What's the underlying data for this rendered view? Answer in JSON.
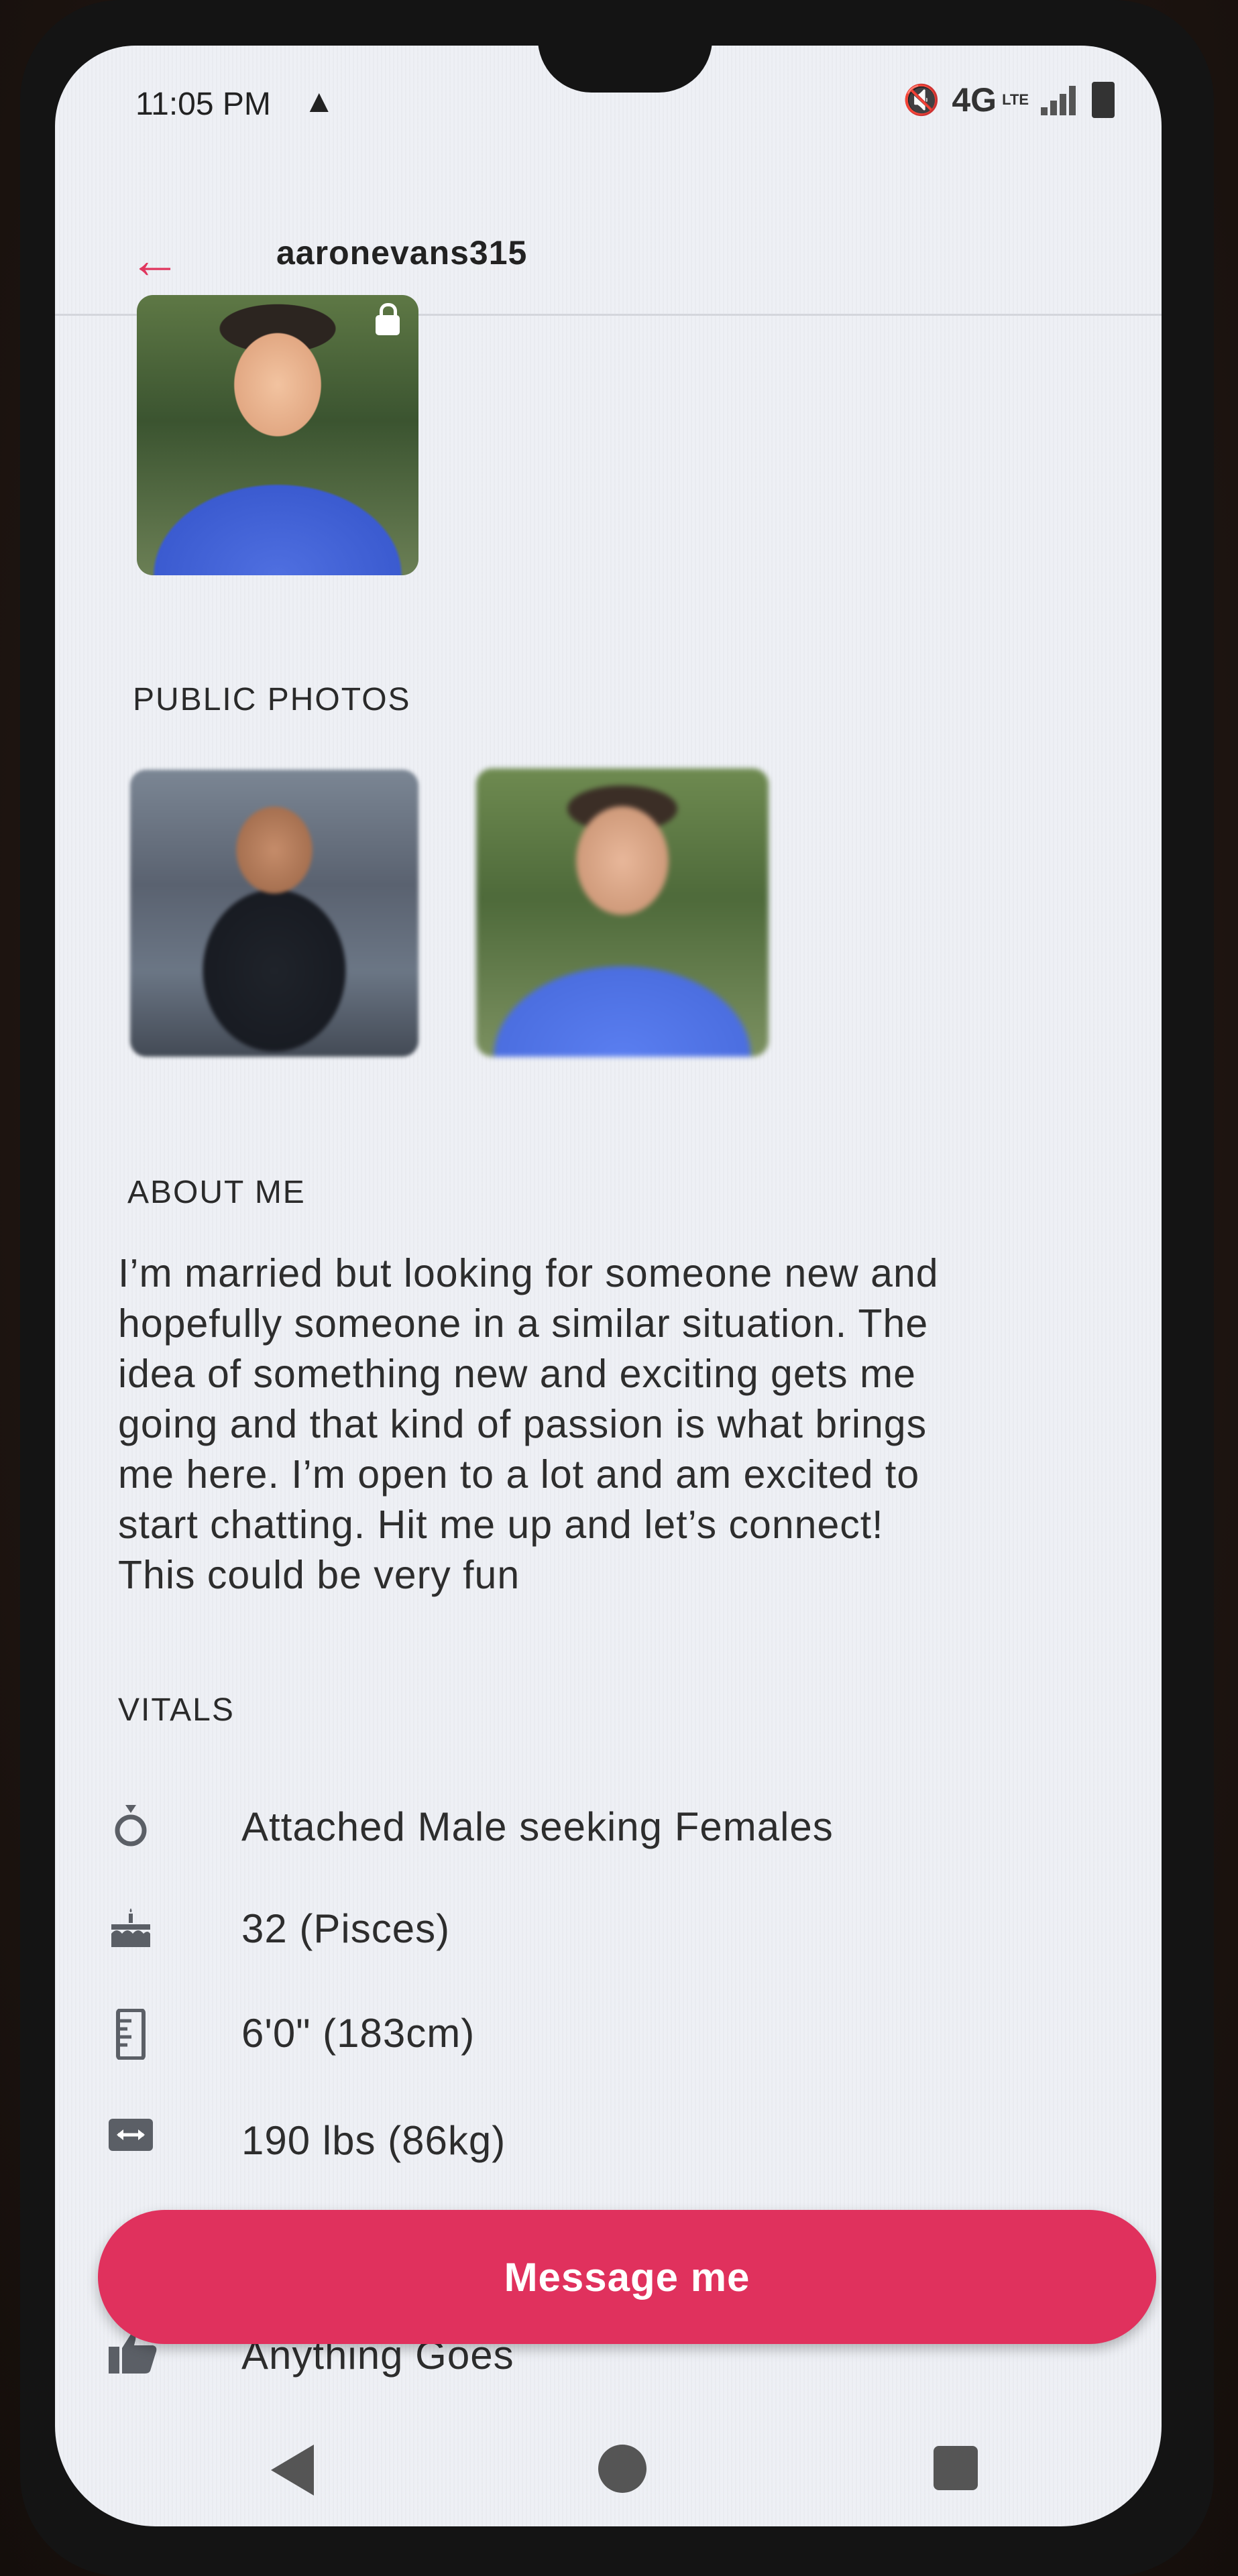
{
  "status_bar": {
    "time": "11:05 PM",
    "warning_icon": "warning-triangle-icon",
    "network": "4G",
    "network_sub": "LTE"
  },
  "header": {
    "back_icon": "arrow-left-icon",
    "username": "aaronevans315"
  },
  "sections": {
    "public_photos": "PUBLIC PHOTOS",
    "about_me": "ABOUT ME",
    "vitals": "VITALS"
  },
  "about": {
    "lines": [
      "I’m married but looking for someone new and",
      "hopefully someone in a similar situation. The",
      "idea of something new and exciting gets me",
      "going and that kind of passion is what brings",
      "me here. I’m open to a lot and am excited to",
      "start chatting. Hit me up and let’s connect!",
      "This could be very fun"
    ]
  },
  "vitals": [
    {
      "icon": "ring-icon",
      "text": "Attached Male seeking Females"
    },
    {
      "icon": "birthday-cake-icon",
      "text": "32 (Pisces)"
    },
    {
      "icon": "ruler-icon",
      "text": "6'0\" (183cm)"
    },
    {
      "icon": "width-arrows-icon",
      "text": "190 lbs (86kg)"
    },
    {
      "icon": "thumbs-up-icon",
      "text": "Anything Goes"
    }
  ],
  "cta": {
    "message_label": "Message me"
  },
  "colors": {
    "accent": "#e0315d",
    "back_arrow": "#e0365e",
    "screen_bg": "#eef0f5"
  }
}
